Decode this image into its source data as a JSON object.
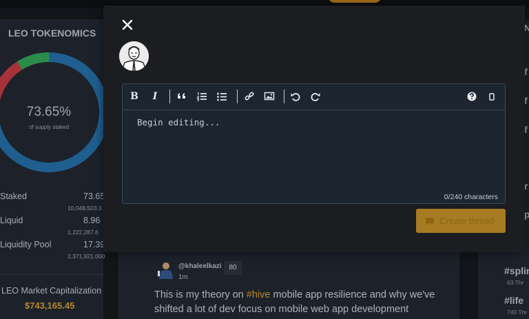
{
  "left_panel": {
    "title": "LEO TOKENOMICS",
    "donut": {
      "percent_label": "73.65%",
      "subtitle": "of supply staked",
      "staked_fraction": 0.7365
    },
    "stats": [
      {
        "label": "Staked",
        "value": "73.65",
        "sub": "10,048,503.3"
      },
      {
        "label": "Liquid",
        "value": "8.96",
        "sub": "1,222,287.6"
      },
      {
        "label": "Liquidity Pool",
        "value": "17.39",
        "sub": "2,371,921.000"
      }
    ],
    "market_cap_label": "LEO Market Capitalization",
    "market_cap_value": "$743,165.45"
  },
  "post": {
    "username": "@khaleelkazi",
    "badge": "80",
    "time": "1m",
    "text_before": "This is my theory on ",
    "hashtag": "#hive",
    "text_after": " mobile app resilience and why we've shifted a lot of dev focus on mobile web app development"
  },
  "right_panel": {
    "items": [
      "N",
      "f",
      "f",
      "f",
      "r",
      "p",
      "#splin",
      "63 Thr",
      "#life",
      "740 Thr"
    ]
  },
  "modal": {
    "editor": {
      "placeholder": "Begin editing...",
      "char_count": "0/240 characters",
      "toolbar": [
        "bold",
        "italic",
        "quote",
        "ordered-list",
        "unordered-list",
        "link",
        "image",
        "undo",
        "redo",
        "help",
        "preview"
      ]
    },
    "create_button_label": "Create thread"
  },
  "colors": {
    "accent": "#b8862a",
    "button": "#a67b22",
    "editor_bg": "#1c2530",
    "donut_staked": "#1f5f8f",
    "donut_liquid": "#2b8c4a",
    "donut_pool": "#a8323a"
  }
}
